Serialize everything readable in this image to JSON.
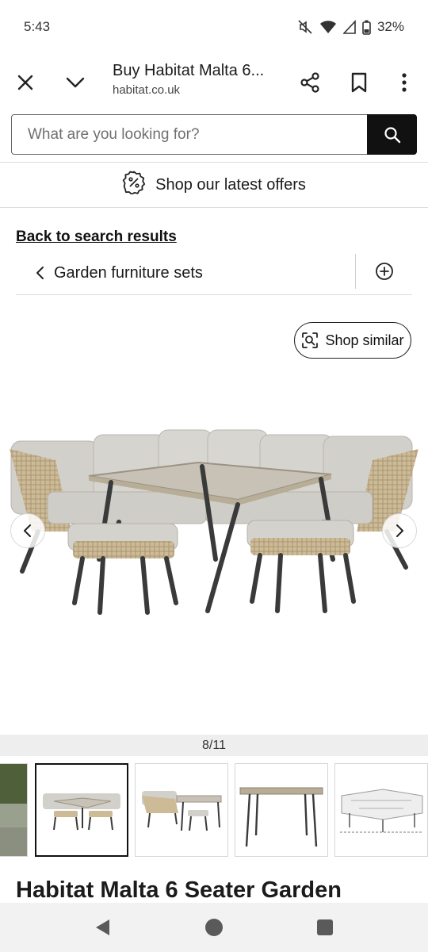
{
  "status": {
    "time": "5:43",
    "battery": "32%"
  },
  "browser": {
    "title": "Buy Habitat Malta 6...",
    "url": "habitat.co.uk"
  },
  "search": {
    "placeholder": "What are you looking for?"
  },
  "offers": {
    "label": "Shop our latest offers"
  },
  "breadcrumb": {
    "back_label": "Back to search results",
    "category": "Garden furniture sets"
  },
  "gallery": {
    "shop_similar_label": "Shop similar",
    "counter": "8/11",
    "thumbnail_count": 5,
    "active_thumbnail": 2
  },
  "product": {
    "title": "Habitat Malta 6 Seater Garden"
  },
  "colors": {
    "primary": "#111111",
    "divider": "#dcdcdc",
    "counter_bg": "#eeeeee"
  }
}
